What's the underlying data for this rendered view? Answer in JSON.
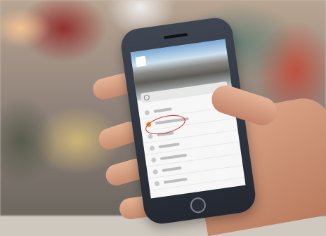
{
  "scene": {
    "description_type": "photo-phone-in-hand",
    "accent": {
      "highlight_circle": "#d52a2a",
      "menu_icon_orange": "#f08a24"
    }
  },
  "phone_screen": {
    "menu_item_count": 7
  }
}
